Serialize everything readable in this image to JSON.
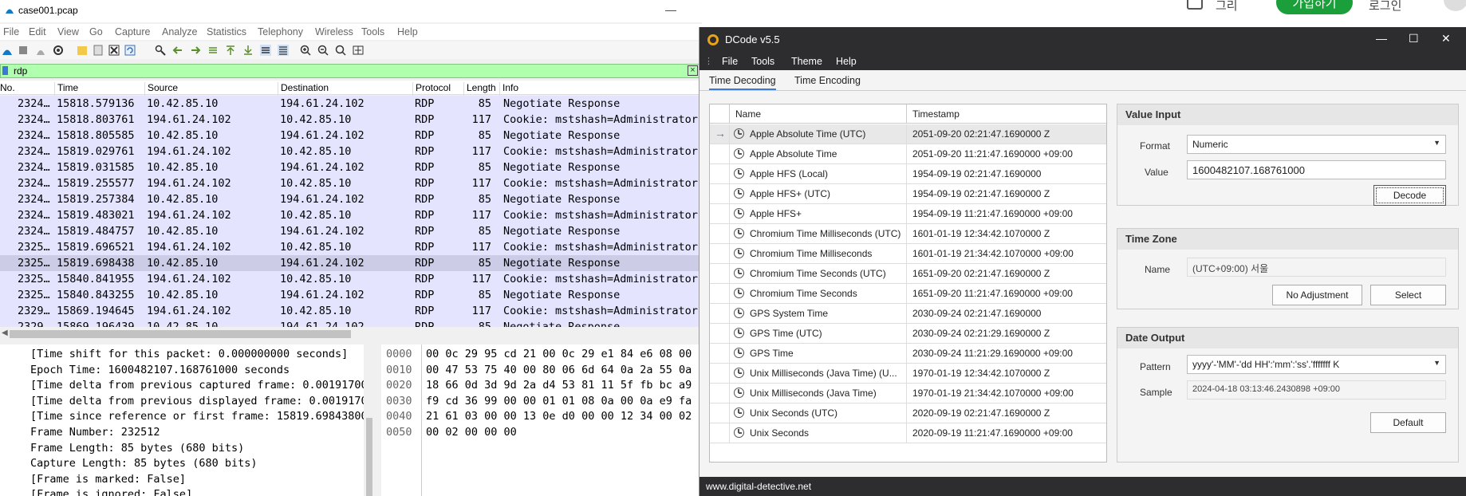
{
  "background_page": {
    "text1": "그리",
    "button": "가입하기",
    "text2": "로그인"
  },
  "wireshark": {
    "title": "case001.pcap",
    "menu": [
      "File",
      "Edit",
      "View",
      "Go",
      "Capture",
      "Analyze",
      "Statistics",
      "Telephony",
      "Wireless",
      "Tools",
      "Help"
    ],
    "filter": "rdp",
    "columns": [
      "No.",
      "Time",
      "Source",
      "Destination",
      "Protocol",
      "Length",
      "Info"
    ],
    "rows": [
      {
        "no": "2324…",
        "time": "15818.579136",
        "src": "10.42.85.10",
        "dst": "194.61.24.102",
        "proto": "RDP",
        "len": "85",
        "info": "Negotiate Response"
      },
      {
        "no": "2324…",
        "time": "15818.803761",
        "src": "194.61.24.102",
        "dst": "10.42.85.10",
        "proto": "RDP",
        "len": "117",
        "info": "Cookie: mstshash=Administrator,"
      },
      {
        "no": "2324…",
        "time": "15818.805585",
        "src": "10.42.85.10",
        "dst": "194.61.24.102",
        "proto": "RDP",
        "len": "85",
        "info": "Negotiate Response"
      },
      {
        "no": "2324…",
        "time": "15819.029761",
        "src": "194.61.24.102",
        "dst": "10.42.85.10",
        "proto": "RDP",
        "len": "117",
        "info": "Cookie: mstshash=Administrator,"
      },
      {
        "no": "2324…",
        "time": "15819.031585",
        "src": "10.42.85.10",
        "dst": "194.61.24.102",
        "proto": "RDP",
        "len": "85",
        "info": "Negotiate Response"
      },
      {
        "no": "2324…",
        "time": "15819.255577",
        "src": "194.61.24.102",
        "dst": "10.42.85.10",
        "proto": "RDP",
        "len": "117",
        "info": "Cookie: mstshash=Administrator,"
      },
      {
        "no": "2324…",
        "time": "15819.257384",
        "src": "10.42.85.10",
        "dst": "194.61.24.102",
        "proto": "RDP",
        "len": "85",
        "info": "Negotiate Response"
      },
      {
        "no": "2324…",
        "time": "15819.483021",
        "src": "194.61.24.102",
        "dst": "10.42.85.10",
        "proto": "RDP",
        "len": "117",
        "info": "Cookie: mstshash=Administrator,"
      },
      {
        "no": "2324…",
        "time": "15819.484757",
        "src": "10.42.85.10",
        "dst": "194.61.24.102",
        "proto": "RDP",
        "len": "85",
        "info": "Negotiate Response"
      },
      {
        "no": "2325…",
        "time": "15819.696521",
        "src": "194.61.24.102",
        "dst": "10.42.85.10",
        "proto": "RDP",
        "len": "117",
        "info": "Cookie: mstshash=Administrator,"
      },
      {
        "no": "2325…",
        "time": "15819.698438",
        "src": "10.42.85.10",
        "dst": "194.61.24.102",
        "proto": "RDP",
        "len": "85",
        "info": "Negotiate Response",
        "selected": true
      },
      {
        "no": "2325…",
        "time": "15840.841955",
        "src": "194.61.24.102",
        "dst": "10.42.85.10",
        "proto": "RDP",
        "len": "117",
        "info": "Cookie: mstshash=Administrator,"
      },
      {
        "no": "2325…",
        "time": "15840.843255",
        "src": "10.42.85.10",
        "dst": "194.61.24.102",
        "proto": "RDP",
        "len": "85",
        "info": "Negotiate Response"
      },
      {
        "no": "2329…",
        "time": "15869.194645",
        "src": "194.61.24.102",
        "dst": "10.42.85.10",
        "proto": "RDP",
        "len": "117",
        "info": "Cookie: mstshash=Administrator,"
      },
      {
        "no": "2329…",
        "time": "15869.196439",
        "src": "10.42.85.10",
        "dst": "194.61.24.102",
        "proto": "RDP",
        "len": "85",
        "info": "Negotiate Response"
      }
    ],
    "details": [
      "[Time shift for this packet: 0.000000000 seconds]",
      "Epoch Time: 1600482107.168761000 seconds",
      "[Time delta from previous captured frame: 0.00191700",
      "[Time delta from previous displayed frame: 0.0019170",
      "[Time since reference or first frame: 15819.69843800",
      "Frame Number: 232512",
      "Frame Length: 85 bytes (680 bits)",
      "Capture Length: 85 bytes (680 bits)",
      "[Frame is marked: False]",
      "[Frame is ignored: False]"
    ],
    "hex": [
      {
        "off": "0000",
        "bytes": "00 0c 29 95 cd 21 00 0c  29 e1 84 e6 08 00"
      },
      {
        "off": "0010",
        "bytes": "00 47 53 75 40 00 80 06  6d 64 0a 2a 55 0a"
      },
      {
        "off": "0020",
        "bytes": "18 66 0d 3d 9d 2a d4 53  81 11 5f fb bc a9"
      },
      {
        "off": "0030",
        "bytes": "f9 cd 36 99 00 00 01 01  08 0a 00 0a e9 fa"
      },
      {
        "off": "0040",
        "bytes": "21 61 03 00 00 13 0e d0  00 00 12 34 00 02"
      },
      {
        "off": "0050",
        "bytes": "00 02 00 00 00"
      }
    ]
  },
  "dcode": {
    "title": "DCode v5.5",
    "menu": [
      "File",
      "Tools",
      "Theme",
      "Help"
    ],
    "tabs": [
      "Time Decoding",
      "Time Encoding"
    ],
    "grid": {
      "headers": [
        "Name",
        "Timestamp"
      ],
      "rows": [
        {
          "name": "Apple Absolute Time (UTC)",
          "ts": "2051-09-20 02:21:47.1690000 Z",
          "selected": true
        },
        {
          "name": "Apple Absolute Time",
          "ts": "2051-09-20 11:21:47.1690000 +09:00"
        },
        {
          "name": "Apple HFS (Local)",
          "ts": "1954-09-19 02:21:47.1690000"
        },
        {
          "name": "Apple HFS+ (UTC)",
          "ts": "1954-09-19 02:21:47.1690000 Z"
        },
        {
          "name": "Apple HFS+",
          "ts": "1954-09-19 11:21:47.1690000 +09:00"
        },
        {
          "name": "Chromium Time Milliseconds (UTC)",
          "ts": "1601-01-19 12:34:42.1070000 Z"
        },
        {
          "name": "Chromium Time Milliseconds",
          "ts": "1601-01-19 21:34:42.1070000 +09:00"
        },
        {
          "name": "Chromium Time Seconds (UTC)",
          "ts": "1651-09-20 02:21:47.1690000 Z"
        },
        {
          "name": "Chromium Time Seconds",
          "ts": "1651-09-20 11:21:47.1690000 +09:00"
        },
        {
          "name": "GPS System Time",
          "ts": "2030-09-24 02:21:47.1690000"
        },
        {
          "name": "GPS Time (UTC)",
          "ts": "2030-09-24 02:21:29.1690000 Z"
        },
        {
          "name": "GPS Time",
          "ts": "2030-09-24 11:21:29.1690000 +09:00"
        },
        {
          "name": "Unix Milliseconds (Java Time) (U...",
          "ts": "1970-01-19 12:34:42.1070000 Z"
        },
        {
          "name": "Unix Milliseconds (Java Time)",
          "ts": "1970-01-19 21:34:42.1070000 +09:00"
        },
        {
          "name": "Unix Seconds (UTC)",
          "ts": "2020-09-19 02:21:47.1690000 Z"
        },
        {
          "name": "Unix Seconds",
          "ts": "2020-09-19 11:21:47.1690000 +09:00"
        }
      ]
    },
    "value_input": {
      "title": "Value Input",
      "format_label": "Format",
      "format_value": "Numeric",
      "value_label": "Value",
      "value": "1600482107.168761000",
      "decode_button": "Decode"
    },
    "time_zone": {
      "title": "Time Zone",
      "name_label": "Name",
      "name_value": "(UTC+09:00) 서울",
      "no_adjustment_button": "No Adjustment",
      "select_button": "Select"
    },
    "date_output": {
      "title": "Date Output",
      "pattern_label": "Pattern",
      "pattern_value": "yyyy'-'MM'-'dd HH':'mm':'ss'.'fffffff K",
      "sample_label": "Sample",
      "sample_value": "2024-04-18 03:13:46.2430898 +09:00",
      "default_button": "Default"
    },
    "status": "www.digital-detective.net"
  }
}
